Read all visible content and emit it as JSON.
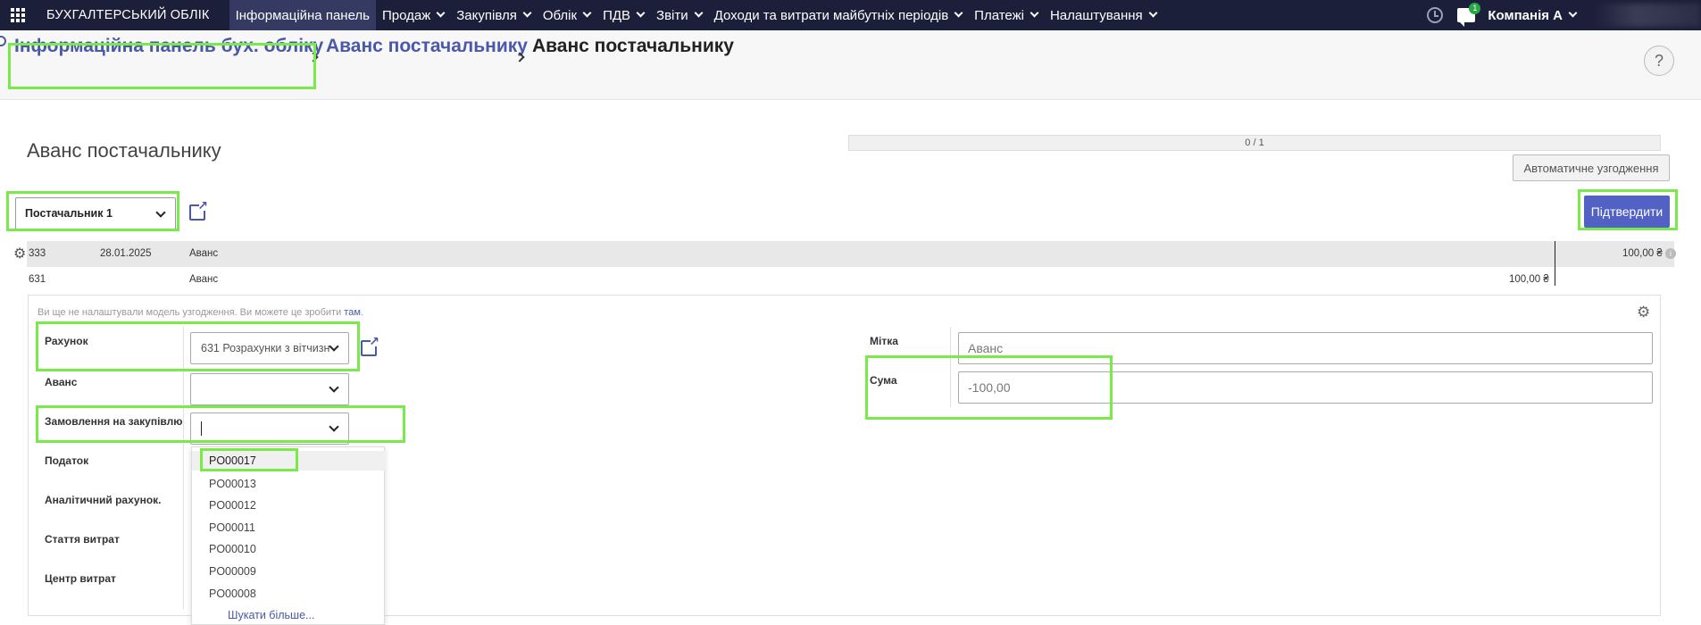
{
  "navbar": {
    "brand": "БУХГАЛТЕРСЬКИЙ ОБЛІК",
    "items": [
      {
        "label": "Інформаційна панель",
        "active": true,
        "dropdown": false
      },
      {
        "label": "Продаж",
        "dropdown": true
      },
      {
        "label": "Закупівля",
        "dropdown": true
      },
      {
        "label": "Облік",
        "dropdown": true
      },
      {
        "label": "ПДВ",
        "dropdown": true
      },
      {
        "label": "Звіти",
        "dropdown": true
      },
      {
        "label": "Доходи та витрати майбутніх періодів",
        "dropdown": true
      },
      {
        "label": "Платежі",
        "dropdown": true
      },
      {
        "label": "Налаштування",
        "dropdown": true
      }
    ],
    "chat_badge": "1",
    "company": "Компанія А",
    "icons": {
      "apps": "apps-grid-icon",
      "clock": "clock-icon",
      "chat": "chat-icon"
    }
  },
  "breadcrumb": {
    "items": [
      "Інформаційна панель бух. обліку",
      "Аванс постачальнику"
    ],
    "current": "Аванс постачальнику",
    "help": "?"
  },
  "main": {
    "heading": "Аванс постачальнику",
    "progress": "0 / 1",
    "progress_fraction": 0,
    "auto_button": "Автоматичне узгодження",
    "partner": "Постачальник 1",
    "confirm_button": "Підтвердити"
  },
  "lines": {
    "header": {
      "account": "333",
      "date": "28.01.2025",
      "label": "Аванс",
      "amount": "100,00 ₴"
    },
    "sub": {
      "account": "631",
      "label": "Аванс",
      "amount": "100,00 ₴"
    }
  },
  "form": {
    "notice_text": "Ви ще не налаштували модель узгодження. Ви можете це зробити ",
    "notice_link": "там",
    "notice_end": ".",
    "labels": {
      "account": "Рахунок",
      "advance": "Аванс",
      "purchase_order": "Замовлення на закупівлю",
      "tax": "Податок",
      "analytic": "Аналітичний рахунок.",
      "expense_item": "Стаття витрат",
      "cost_center": "Центр витрат",
      "tag": "Мітка",
      "amount": "Сума"
    },
    "account_value": "631 Розрахунки з вітчизн",
    "tag_value": "Аванс",
    "amount_value": "-100,00",
    "dropdown_items": [
      "PO00017",
      "PO00013",
      "PO00012",
      "PO00011",
      "PO00010",
      "PO00009",
      "PO00008"
    ],
    "dropdown_more": "Шукати більше..."
  },
  "colors": {
    "navbar_bg": "#1c1f3a",
    "link": "#4a58a8",
    "primary_button": "#5262c4",
    "highlight": "#7aea4b"
  }
}
